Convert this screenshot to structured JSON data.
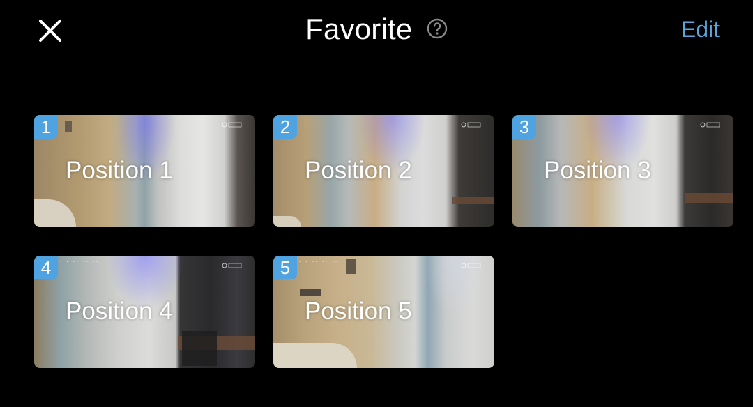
{
  "header": {
    "title": "Favorite",
    "edit_label": "Edit",
    "close_icon": "close-icon",
    "help_icon": "help-circle-icon"
  },
  "colors": {
    "background": "#000000",
    "accent": "#5aa6dc",
    "badge": "#4ea3e0",
    "text": "#ffffff"
  },
  "positions": [
    {
      "number": "1",
      "label": "Position 1"
    },
    {
      "number": "2",
      "label": "Position 2"
    },
    {
      "number": "3",
      "label": "Position 3"
    },
    {
      "number": "4",
      "label": "Position 4"
    },
    {
      "number": "5",
      "label": "Position 5"
    }
  ]
}
